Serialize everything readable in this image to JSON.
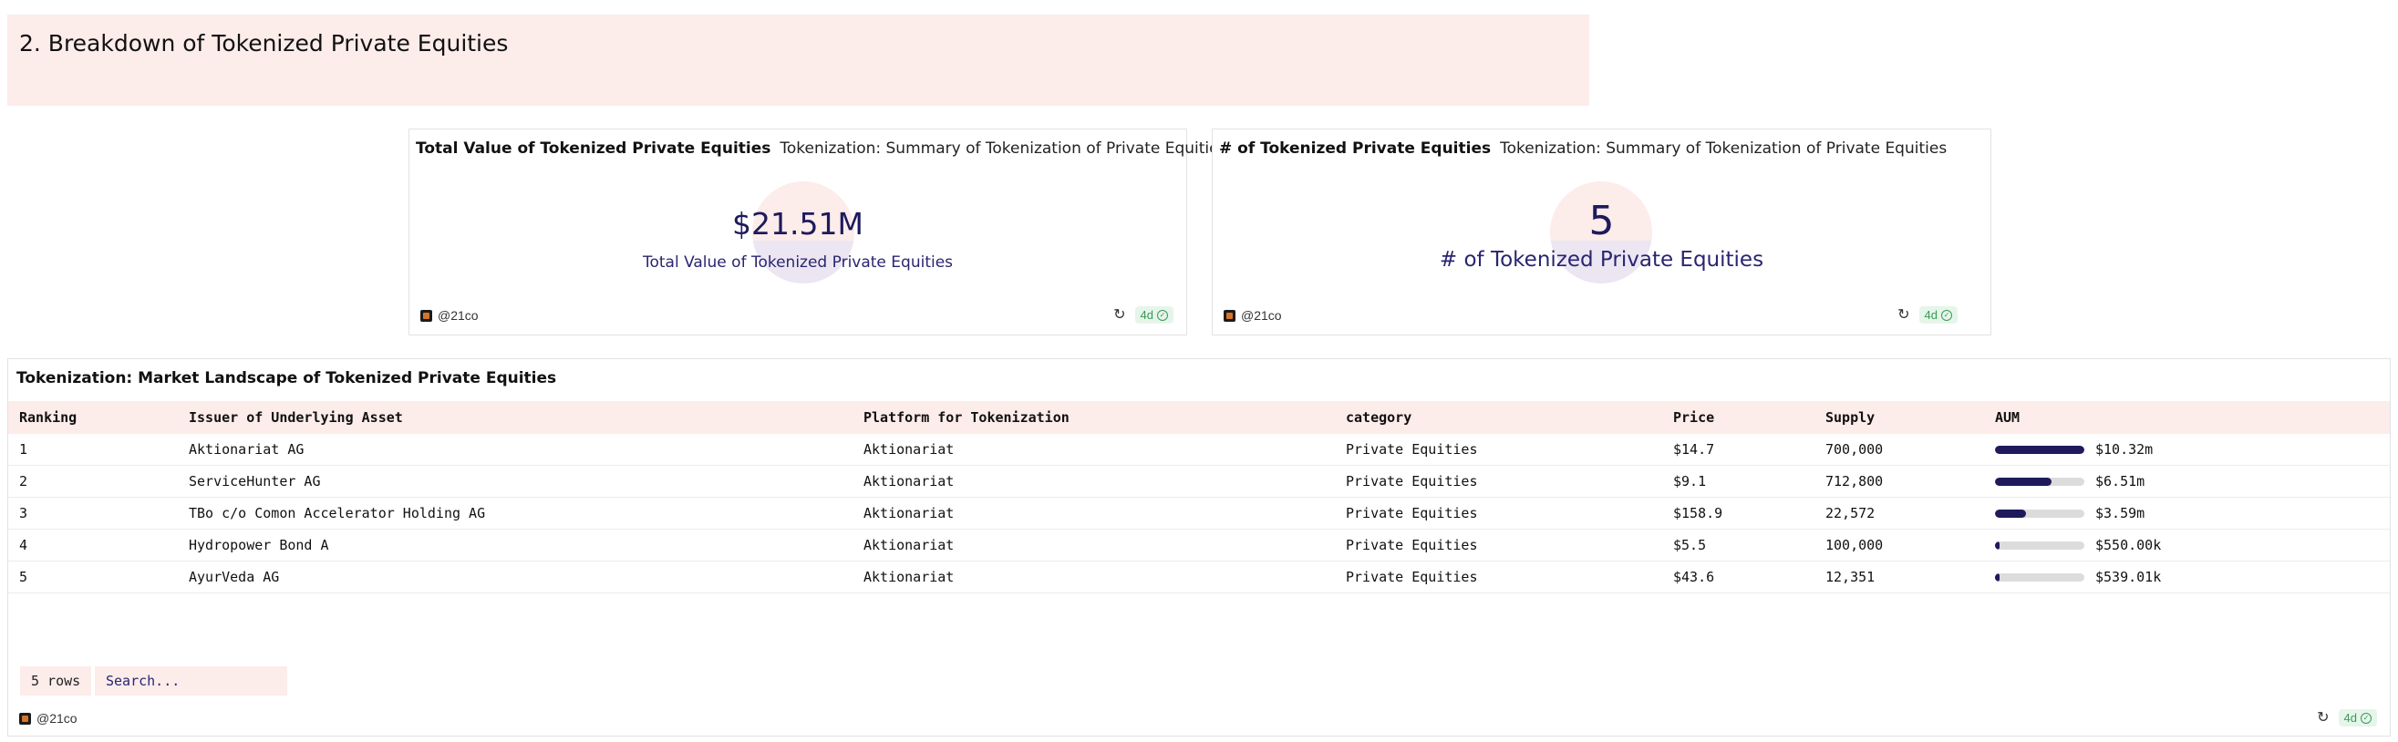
{
  "section": {
    "title": "2. Breakdown of Tokenized Private Equities"
  },
  "cards": [
    {
      "title": "Total Value of Tokenized Private Equities",
      "subtitle": "Tokenization: Summary of Tokenization of Private Equities",
      "value": "$21.51M",
      "label": "Total Value of Tokenized Private Equities",
      "author": "@21co",
      "age": "4d"
    },
    {
      "title": "# of Tokenized Private Equities",
      "subtitle": "Tokenization: Summary of Tokenization of Private Equities",
      "value": "5",
      "label": "# of Tokenized Private Equities",
      "author": "@21co",
      "age": "4d"
    }
  ],
  "table": {
    "title": "Tokenization: Market Landscape of Tokenized Private Equities",
    "columns": [
      "Ranking",
      "Issuer of Underlying Asset",
      "Platform for Tokenization",
      "category",
      "Price",
      "Supply",
      "AUM"
    ],
    "rows": [
      {
        "ranking": "1",
        "issuer": "Aktionariat AG",
        "platform": "Aktionariat",
        "category": "Private Equities",
        "price": "$14.7",
        "supply": "700,000",
        "aum": "$10.32m",
        "aum_fraction": 1.0
      },
      {
        "ranking": "2",
        "issuer": "ServiceHunter AG",
        "platform": "Aktionariat",
        "category": "Private Equities",
        "price": "$9.1",
        "supply": "712,800",
        "aum": "$6.51m",
        "aum_fraction": 0.63
      },
      {
        "ranking": "3",
        "issuer": "TBo c/o Comon Accelerator Holding AG",
        "platform": "Aktionariat",
        "category": "Private Equities",
        "price": "$158.9",
        "supply": "22,572",
        "aum": "$3.59m",
        "aum_fraction": 0.35
      },
      {
        "ranking": "4",
        "issuer": "Hydropower Bond A",
        "platform": "Aktionariat",
        "category": "Private Equities",
        "price": "$5.5",
        "supply": "100,000",
        "aum": "$550.00k",
        "aum_fraction": 0.053
      },
      {
        "ranking": "5",
        "issuer": "AyurVeda AG",
        "platform": "Aktionariat",
        "category": "Private Equities",
        "price": "$43.6",
        "supply": "12,351",
        "aum": "$539.01k",
        "aum_fraction": 0.052
      }
    ],
    "row_count": "5 rows",
    "search_placeholder": "Search...",
    "author": "@21co",
    "age": "4d"
  },
  "colors": {
    "accent": "#1e1a5c",
    "header_bg": "#fcecea",
    "badge_green": "#3a9a55"
  },
  "icons": [
    "refresh-icon",
    "check-circle-icon",
    "avatar-icon"
  ]
}
